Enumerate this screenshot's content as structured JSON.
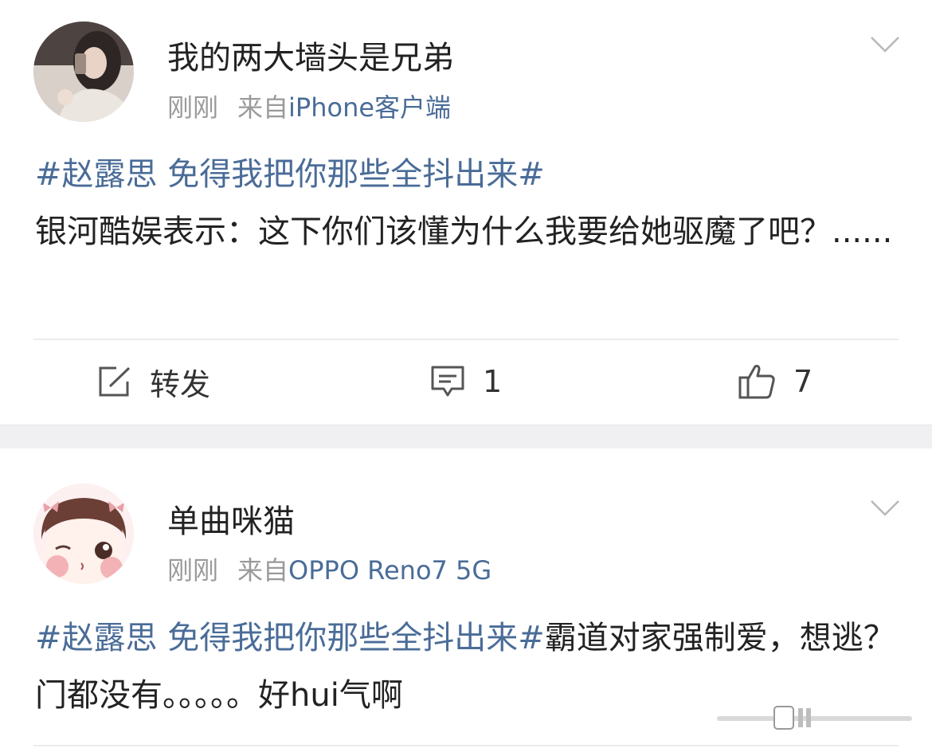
{
  "posts": [
    {
      "username": "我的两大墙头是兄弟",
      "time": "刚刚",
      "source_prefix": "来自",
      "source_device": "iPhone客户端",
      "hashtag": "#赵露思 免得我把你那些全抖出来#",
      "text": "银河酷娱表示：这下你们该懂为什么我要给她驱魔了吧？......",
      "actions": {
        "repost_label": "转发",
        "comment_count": "1",
        "like_count": "7"
      }
    },
    {
      "username": "单曲咪猫",
      "time": "刚刚",
      "source_prefix": "来自",
      "source_device": "OPPO Reno7 5G",
      "hashtag": "#赵露思 免得我把你那些全抖出来#",
      "text": "霸道对家强制爱，想逃？门都没有。。。。。好hui气啊"
    }
  ],
  "icons": {
    "repost": "edit-share-icon",
    "comment": "comment-bubble-icon",
    "like": "thumbs-up-icon",
    "menu": "chevron-down-icon"
  },
  "colors": {
    "link": "#4a6c98",
    "meta": "#9a9a9a",
    "text": "#222222",
    "separator": "#f0f0f2"
  }
}
